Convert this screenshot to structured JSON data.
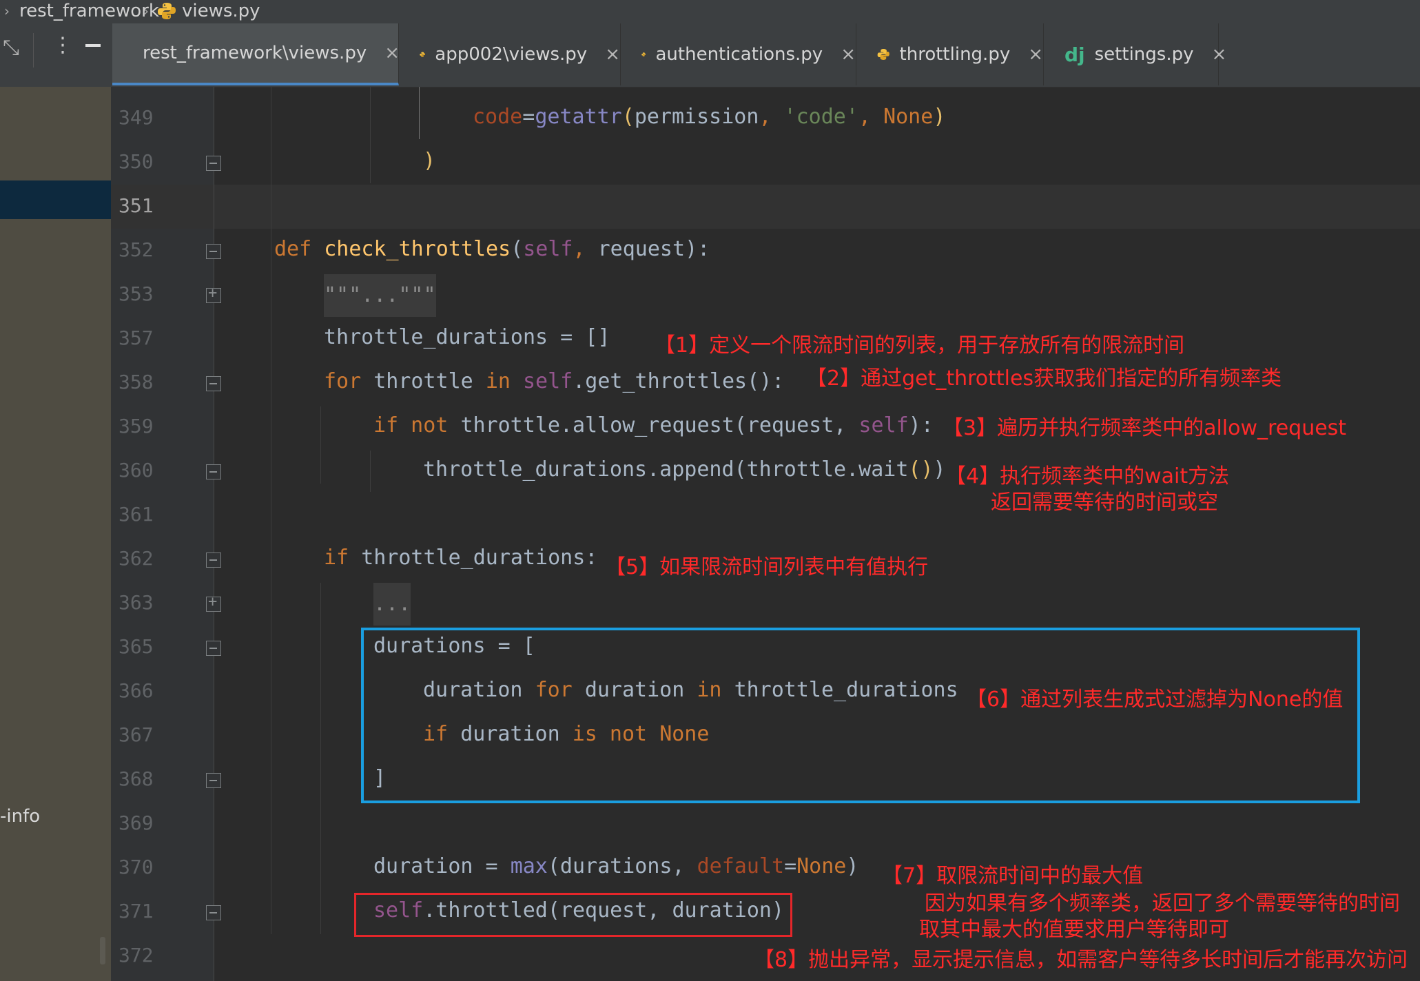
{
  "breadcrumb": {
    "folder": "rest_framework",
    "file": "views.py"
  },
  "left_panel": {
    "label": "-info"
  },
  "tabs": [
    {
      "label": "rest_framework\\views.py",
      "icon": "python-icon",
      "active": true
    },
    {
      "label": "app002\\views.py",
      "icon": "python-icon",
      "active": false
    },
    {
      "label": "authentications.py",
      "icon": "python-icon",
      "active": false
    },
    {
      "label": "throttling.py",
      "icon": "python-icon",
      "active": false
    },
    {
      "label": "settings.py",
      "icon": "django-icon",
      "active": false
    }
  ],
  "tab_close_glyph": "×",
  "django_icon_text": "dj",
  "line_numbers": [
    "349",
    "350",
    "351",
    "352",
    "353",
    "357",
    "358",
    "359",
    "360",
    "361",
    "362",
    "363",
    "365",
    "366",
    "367",
    "368",
    "369",
    "370",
    "371",
    "372"
  ],
  "code": {
    "l349": [
      "code",
      "=",
      "getattr",
      "(",
      "permission",
      ", ",
      "'code'",
      ", ",
      "None",
      ")"
    ],
    "l350": [
      ")"
    ],
    "l352": [
      "def ",
      "check_throttles",
      "(",
      "self",
      ", ",
      "request",
      "):"
    ],
    "l353": [
      "\"\"\"...\"\"\""
    ],
    "l357": [
      "throttle_durations = []"
    ],
    "l358": [
      "for ",
      "throttle ",
      "in ",
      "self",
      ".get_throttles():"
    ],
    "l359": [
      "if not ",
      "throttle.allow_request(request, ",
      "self",
      "):"
    ],
    "l360": [
      "throttle_durations.append(throttle.wait",
      "()",
      ")"
    ],
    "l362": [
      "if ",
      "throttle_durations:"
    ],
    "l363": [
      "..."
    ],
    "l365": [
      "durations = ["
    ],
    "l366": [
      "duration ",
      "for ",
      "duration ",
      "in ",
      "throttle_durations"
    ],
    "l367": [
      "if ",
      "duration ",
      "is not ",
      "None"
    ],
    "l368": [
      "]"
    ],
    "l370": [
      "duration = ",
      "max",
      "(durations, ",
      "default",
      "=",
      "None",
      ")"
    ],
    "l371": [
      "self",
      ".throttled(request, duration)"
    ]
  },
  "annotations": {
    "n1": "【1】定义一个限流时间的列表，用于存放所有的限流时间",
    "n2": "【2】通过get_throttles获取我们指定的所有频率类",
    "n3": "【3】遍历并执行频率类中的allow_request",
    "n4a": "【4】执行频率类中的wait方法",
    "n4b": "返回需要等待的时间或空",
    "n5": "【5】如果限流时间列表中有值执行",
    "n6": "【6】通过列表生成式过滤掉为None的值",
    "n7a": "【7】取限流时间中的最大值",
    "n7b": "因为如果有多个频率类，返回了多个需要等待的时间",
    "n7c": "取其中最大的值要求用户等待即可",
    "n8": "【8】抛出异常，显示提示信息，如需客户等待多长时间后才能再次访问"
  },
  "colors": {
    "editor_bg": "#2b2b2b",
    "keyword": "#cc7832",
    "function": "#ffc66d",
    "self": "#94558d",
    "string": "#6a8759",
    "annotation": "#ff2a2a",
    "highlight_blue": "#1a9ee0",
    "highlight_red": "#e4262a"
  }
}
